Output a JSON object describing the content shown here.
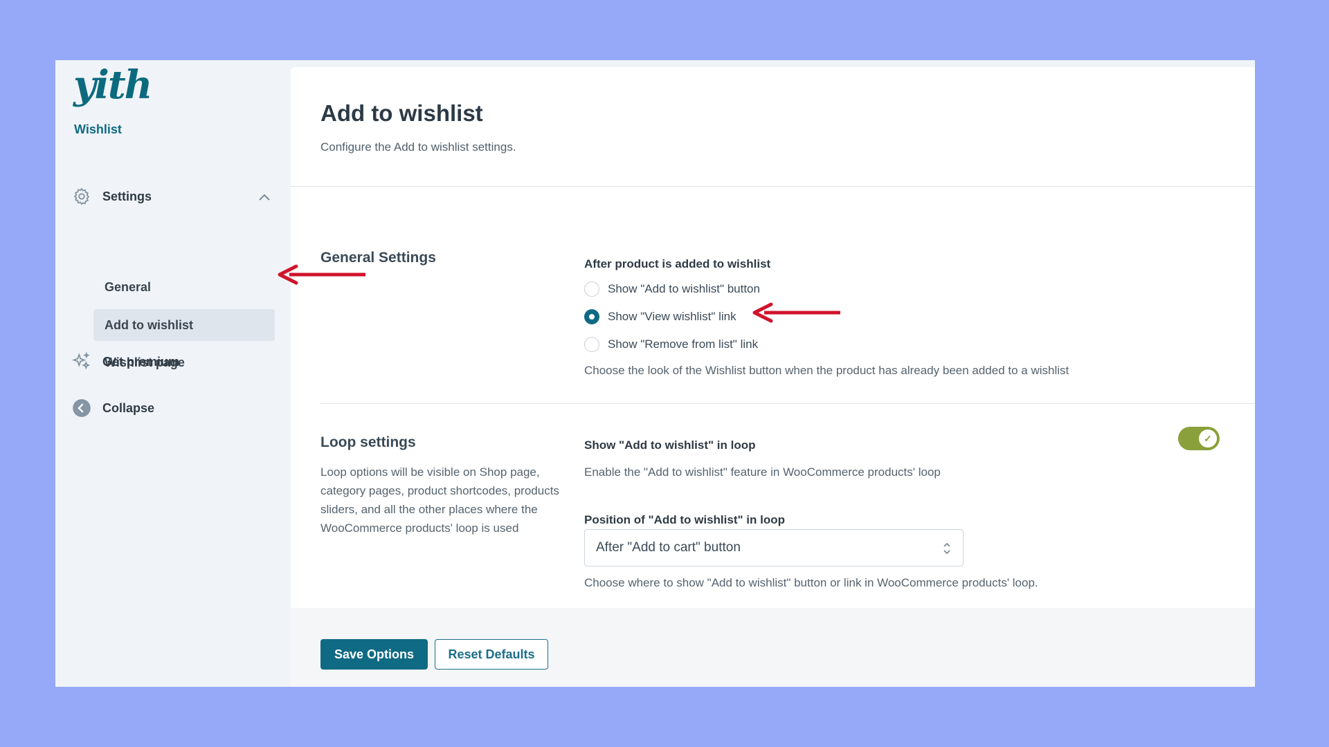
{
  "app": {
    "logo_text": "yith",
    "logo_sub": "Wishlist"
  },
  "sidebar": {
    "settings_label": "Settings",
    "items": [
      {
        "label": "General"
      },
      {
        "label": "Add to wishlist",
        "active": true
      },
      {
        "label": "Wishlist page"
      }
    ],
    "premium_label": "Get premium",
    "collapse_label": "Collapse"
  },
  "header": {
    "title": "Add to wishlist",
    "description": "Configure the Add to wishlist settings."
  },
  "general_settings": {
    "section_title": "General Settings",
    "field_label": "After product is added to wishlist",
    "options": [
      {
        "label": "Show \"Add to wishlist\" button",
        "checked": false
      },
      {
        "label": "Show \"View wishlist\" link",
        "checked": true
      },
      {
        "label": "Show \"Remove from list\" link",
        "checked": false
      }
    ],
    "help": "Choose the look of the Wishlist button when the product has already been added to a wishlist"
  },
  "loop_settings": {
    "section_title": "Loop settings",
    "description": "Loop options will be visible on Shop page, category pages, product shortcodes, products sliders, and all the other places where the WooCommerce products' loop is used",
    "show_label": "Show \"Add to wishlist\" in loop",
    "show_enabled": true,
    "show_help": "Enable the \"Add to wishlist\" feature in WooCommerce products' loop",
    "position_label": "Position of \"Add to wishlist\" in loop",
    "position_value": "After \"Add to cart\" button",
    "position_help": "Choose where to show \"Add to wishlist\" button or link in WooCommerce products' loop."
  },
  "footer": {
    "save_label": "Save Options",
    "reset_label": "Reset Defaults"
  },
  "colors": {
    "accent": "#0f6a84",
    "toggle_on": "#8aa03a",
    "annotation_arrow": "#d0142c",
    "background": "#96a8f8"
  }
}
